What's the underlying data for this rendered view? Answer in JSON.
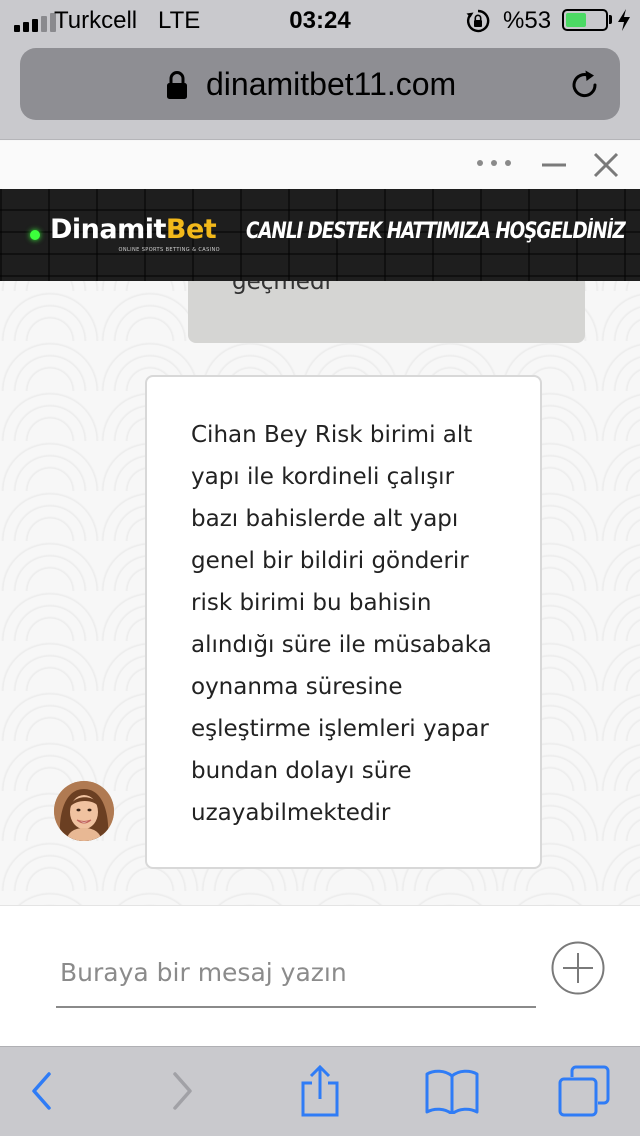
{
  "status_bar": {
    "carrier": "Turkcell",
    "network": "LTE",
    "time": "03:24",
    "battery_percent": "%53",
    "battery_level": 0.53,
    "icons": [
      "signal-icon",
      "orientation-lock-icon",
      "battery-icon",
      "charging-bolt-icon"
    ]
  },
  "browser": {
    "url": "dinamitbet11.com",
    "icons": [
      "lock-icon",
      "reload-icon"
    ]
  },
  "chat": {
    "window_icons": [
      "more-icon",
      "minimize-icon",
      "close-icon"
    ],
    "banner": {
      "logo_main_a": "Dinamit",
      "logo_main_b": "Bet",
      "logo_sub": "ONLINE SPORTS BETTING & CASINO",
      "headline": "CANLI DESTEK HATTIMIZA HOŞGELDİNİZ"
    },
    "previous_message_fragment": "geçmedi",
    "agent_message_lines": [
      "Cihan Bey Risk birimi alt",
      "yapı ile kordineli çalışır",
      "bazı bahislerde alt yapı",
      "genel bir bildiri gönderir",
      "risk birimi bu bahisin",
      "alındığı süre ile müsabaka",
      "oynanma süresine",
      "eşleştirme işlemleri yapar",
      "bundan dolayı süre",
      "uzayabilmektedir"
    ],
    "input_placeholder": "Buraya bir mesaj yazın"
  },
  "toolbar": {
    "icons": [
      "back-icon",
      "forward-icon",
      "share-icon",
      "bookmarks-icon",
      "tabs-icon"
    ]
  },
  "colors": {
    "ios_chrome": "#c9c9cd",
    "ios_blue": "#2f7cf6",
    "battery_green": "#4cd964",
    "brand_gold": "#f2b81a",
    "online_dot": "#3cff3c"
  }
}
